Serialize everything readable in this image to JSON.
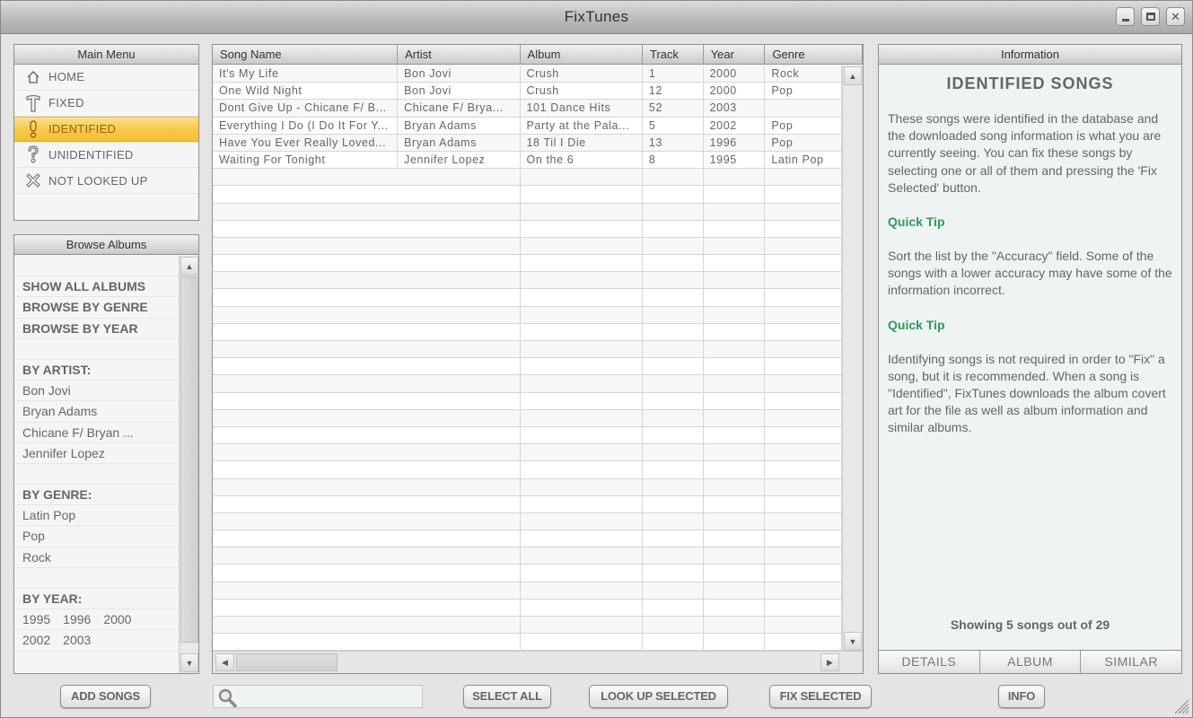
{
  "window": {
    "title": "FixTunes",
    "controls": {
      "minimize": "minimize-icon",
      "maximize": "maximize-icon",
      "close": "close-icon"
    }
  },
  "main_menu": {
    "header": "Main Menu",
    "items": [
      {
        "label": "HOME",
        "icon": "home-icon",
        "glyph": "⌂",
        "active": false
      },
      {
        "label": "FIXED",
        "icon": "hammer-icon",
        "glyph": "T",
        "active": false
      },
      {
        "label": "IDENTIFIED",
        "icon": "exclamation-icon",
        "glyph": "!",
        "active": true
      },
      {
        "label": "UNIDENTIFIED",
        "icon": "question-icon",
        "glyph": "?",
        "active": false
      },
      {
        "label": "NOT LOOKED UP",
        "icon": "x-mark-icon",
        "glyph": "✕",
        "active": false
      }
    ],
    "active_color": "#f8c84a"
  },
  "browse_albums": {
    "header": "Browse Albums",
    "show_all": "SHOW ALL ALBUMS",
    "browse_by_genre": "BROWSE BY GENRE",
    "browse_by_year": "BROWSE BY YEAR",
    "by_artist_label": "BY ARTIST:",
    "artists": [
      "Bon Jovi",
      "Bryan Adams",
      "Chicane F/ Bryan ...",
      "Jennifer Lopez"
    ],
    "by_genre_label": "BY GENRE:",
    "genres": [
      "Latin Pop",
      "Pop",
      "Rock"
    ],
    "by_year_label": "BY YEAR:",
    "years_row1": [
      "1995",
      "1996",
      "2000"
    ],
    "years_row2": [
      "2002",
      "2003"
    ]
  },
  "song_table": {
    "columns": [
      "Song Name",
      "Artist",
      "Album",
      "Track",
      "Year",
      "Genre"
    ],
    "rows": [
      [
        "It's My Life",
        "Bon Jovi",
        "Crush",
        "1",
        "2000",
        "Rock"
      ],
      [
        "One Wild Night",
        "Bon Jovi",
        "Crush",
        "12",
        "2000",
        "Pop"
      ],
      [
        "Dont Give Up - Chicane F/ B...",
        "Chicane F/ Brya...",
        "101 Dance Hits",
        "52",
        "2003",
        ""
      ],
      [
        "Everything I Do (I Do It For Y...",
        "Bryan Adams",
        "Party at the Pala...",
        "5",
        "2002",
        "Pop"
      ],
      [
        "Have You Ever Really Loved...",
        "Bryan Adams",
        "18 Til I Die",
        "13",
        "1996",
        "Pop"
      ],
      [
        "Waiting For Tonight",
        "Jennifer Lopez",
        "On the 6",
        "8",
        "1995",
        "Latin Pop"
      ]
    ]
  },
  "information": {
    "header": "Information",
    "title": "IDENTIFIED SONGS",
    "paragraph1": "These songs were identified in the database and the downloaded song information is what you are currently seeing. You can fix these songs by selecting one or all of them and pressing the 'Fix Selected' button.",
    "tip1_label": "Quick Tip",
    "tip1_text": "Sort the list by the \"Accuracy\" field. Some of the songs with a lower accuracy may have some of the information incorrect.",
    "tip2_label": "Quick Tip",
    "tip2_text": "Identifying songs is not required in order to \"Fix\" a song, but it is recommended. When a song is \"Identified\", FixTunes downloads the album covert art for the file as well as album information and similar albums.",
    "status": "Showing 5 songs out of 29",
    "tabs": [
      "DETAILS",
      "ALBUM",
      "SIMILAR"
    ],
    "tip_color": "#2e9a5a"
  },
  "toolbar": {
    "add_songs": "ADD SONGS",
    "search_placeholder": "",
    "search_value": "",
    "select_all": "SELECT ALL",
    "look_up_selected": "LOOK UP SELECTED",
    "fix_selected": "FIX SELECTED",
    "info": "INFO"
  }
}
